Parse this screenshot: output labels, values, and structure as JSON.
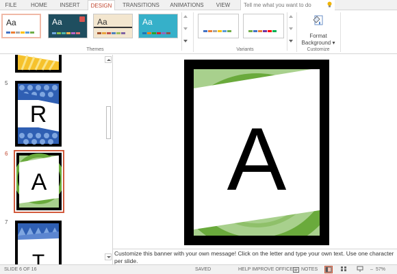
{
  "tabs": [
    {
      "label": "FILE",
      "active": false
    },
    {
      "label": "HOME",
      "active": false
    },
    {
      "label": "INSERT",
      "active": false
    },
    {
      "label": "DESIGN",
      "active": true
    },
    {
      "label": "TRANSITIONS",
      "active": false
    },
    {
      "label": "ANIMATIONS",
      "active": false
    },
    {
      "label": "VIEW",
      "active": false
    }
  ],
  "tellme": {
    "placeholder": "Tell me what you want to do",
    "icon": "lightbulb-icon"
  },
  "themes": {
    "group_label": "Themes",
    "items": [
      {
        "label": "Aa",
        "bg": "#ffffff",
        "text": "#222222",
        "swatches": [
          "#4472c4",
          "#ed7d31",
          "#a5a5a5",
          "#ffc000",
          "#5b9bd5",
          "#70ad47"
        ]
      },
      {
        "label": "Aa",
        "bg": "#1f4e5f",
        "text": "#ffffff",
        "swatches": [
          "#6fa8dc",
          "#8bc34a",
          "#4db6ac",
          "#ffb74d",
          "#ba68c8",
          "#e57373"
        ]
      },
      {
        "label": "Aa",
        "bg": "#f3e6cf",
        "text": "#333333",
        "swatches": [
          "#a0522d",
          "#e8a33d",
          "#c0504d",
          "#4f81bd",
          "#9bbb59",
          "#8064a2"
        ]
      },
      {
        "label": "Aa",
        "bg": "#36b0c9",
        "text": "#ffffff",
        "swatches": [
          "#1f77b4",
          "#ff7f0e",
          "#2ca02c",
          "#d62728",
          "#9467bd",
          "#8c564b"
        ]
      }
    ]
  },
  "variants": {
    "group_label": "Variants",
    "items": [
      {
        "swatches": [
          "#4472c4",
          "#ed7d31",
          "#a5a5a5",
          "#ffc000",
          "#5b9bd5",
          "#70ad47"
        ]
      },
      {
        "swatches": [
          "#70ad47",
          "#4472c4",
          "#ed7d31",
          "#7030a0",
          "#ff0000",
          "#00b050"
        ]
      }
    ]
  },
  "customize": {
    "group_label": "Customize",
    "format_background_line1": "Format",
    "format_background_line2": "Background ▾"
  },
  "slides": [
    {
      "number": "5",
      "letter": "R",
      "theme": "blue"
    },
    {
      "number": "6",
      "letter": "A",
      "theme": "green",
      "selected": true
    },
    {
      "number": "7",
      "letter": "T",
      "theme": "blue-triangles"
    }
  ],
  "main_slide": {
    "letter": "A"
  },
  "notes": {
    "text": "Customize this banner with your own message! Click on the letter and type your own text. Use one character per slide."
  },
  "status": {
    "slide_indicator": "SLIDE 6 OF 16",
    "saved": "SAVED",
    "help": "HELP IMPROVE OFFICE",
    "notes_label": "NOTES",
    "zoom": "57%"
  },
  "colors": {
    "accent": "#c0452d",
    "green_dark": "#6aaa3c",
    "green_light": "#a8d08d",
    "blue_dark": "#2f5fb3",
    "blue_light": "#7fa6e0"
  }
}
